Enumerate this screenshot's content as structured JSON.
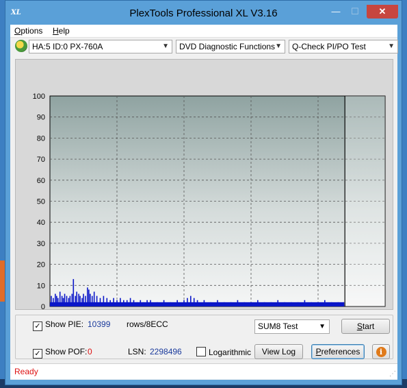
{
  "window": {
    "title": "PlexTools Professional XL V3.16",
    "logo_text": "XL"
  },
  "window_controls": {
    "minimize": "—",
    "maximize": "☐",
    "close": "✕"
  },
  "menu": {
    "options": {
      "underlined": "O",
      "rest": "ptions"
    },
    "help": {
      "underlined": "H",
      "rest": "elp"
    }
  },
  "toolbar": {
    "drive": "HA:5 ID:0  PX-760A",
    "function": "DVD Diagnostic Functions",
    "test": "Q-Check PI/PO Test",
    "arrow": "▼"
  },
  "chart_data": {
    "type": "bar",
    "x_ticks": [
      "0",
      "1",
      "2",
      "3",
      "4",
      "5"
    ],
    "y_ticks": [
      "0",
      "10",
      "20",
      "30",
      "40",
      "50",
      "60",
      "70",
      "80",
      "90",
      "100"
    ],
    "xlim": [
      0,
      5
    ],
    "ylim": [
      0,
      100
    ],
    "end_marker_x": 4.4,
    "grid": true,
    "series": [
      {
        "color": "#0a16c8",
        "description": "PI errors",
        "x": [
          0.02,
          0.05,
          0.08,
          0.1,
          0.12,
          0.15,
          0.18,
          0.2,
          0.22,
          0.25,
          0.28,
          0.3,
          0.33,
          0.35,
          0.38,
          0.4,
          0.43,
          0.45,
          0.48,
          0.5,
          0.53,
          0.56,
          0.58,
          0.6,
          0.63,
          0.66,
          0.7,
          0.75,
          0.8,
          0.85,
          0.9,
          0.95,
          1.0,
          1.05,
          1.1,
          1.15,
          1.2,
          1.25,
          1.3,
          1.35,
          1.4,
          1.45,
          1.5,
          1.6,
          1.7,
          1.8,
          1.9,
          2.0,
          2.05,
          2.1,
          2.15,
          2.2,
          2.3,
          2.4,
          2.5,
          2.6,
          2.7,
          2.8,
          2.9,
          3.0,
          3.1,
          3.2,
          3.3,
          3.4,
          3.5,
          3.6,
          3.7,
          3.8,
          3.9,
          4.0,
          4.1,
          4.2,
          4.3,
          4.38
        ],
        "y": [
          5,
          4,
          6,
          5,
          4,
          7,
          5,
          4,
          6,
          5,
          4,
          5,
          6,
          13,
          5,
          7,
          6,
          5,
          4,
          6,
          5,
          9,
          8,
          6,
          5,
          7,
          5,
          4,
          5,
          4,
          3,
          4,
          3,
          4,
          3,
          3,
          4,
          3,
          2,
          3,
          2,
          3,
          3,
          2,
          3,
          2,
          3,
          3,
          4,
          5,
          4,
          3,
          3,
          2,
          3,
          2,
          2,
          3,
          2,
          2,
          3,
          2,
          2,
          3,
          2,
          2,
          2,
          3,
          2,
          2,
          3,
          2,
          2,
          2
        ]
      }
    ]
  },
  "controls": {
    "show_pie": {
      "label": "Show PIE:",
      "checked": "✓",
      "value": "10399",
      "unit": "rows/8ECC"
    },
    "show_poe": {
      "label": "Show POF:",
      "checked": "✓",
      "value": "0"
    },
    "lsn": {
      "label": "LSN:",
      "value": "2298496"
    },
    "logarithmic": {
      "label": "Logarithmic",
      "checked": ""
    },
    "test_select": "SUM8 Test",
    "start": {
      "underlined": "S",
      "rest": "tart"
    },
    "view_log": "View Log",
    "preferences": {
      "underlined": "P",
      "rest": "references"
    },
    "info": "i"
  },
  "status": {
    "text": "Ready"
  }
}
